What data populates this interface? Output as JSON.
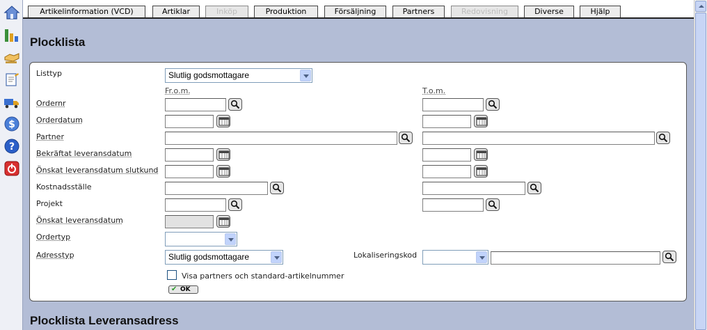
{
  "nav_tabs": [
    {
      "label": "Artikelinformation (VCD)",
      "enabled": true
    },
    {
      "label": "Artiklar",
      "enabled": true
    },
    {
      "label": "Inköp",
      "enabled": false
    },
    {
      "label": "Produktion",
      "enabled": true
    },
    {
      "label": "Försäljning",
      "enabled": true
    },
    {
      "label": "Partners",
      "enabled": true
    },
    {
      "label": "Redovisning",
      "enabled": false
    },
    {
      "label": "Diverse",
      "enabled": true
    },
    {
      "label": "Hjälp",
      "enabled": true
    }
  ],
  "left_icons": [
    "home-icon",
    "chart-icon",
    "handshake-icon",
    "notepad-icon",
    "truck-icon",
    "dollar-icon",
    "help-icon",
    "power-icon"
  ],
  "page": {
    "title": "Plocklista",
    "section2_title": "Plocklista Leveransadress"
  },
  "form": {
    "listtyp_label": "Listtyp",
    "listtyp_value": "Slutlig godsmottagare",
    "from_header": "Fr.o.m.",
    "to_header": "T.o.m.",
    "ordernr_label": "Ordernr",
    "orderdatum_label": "Orderdatum",
    "partner_label": "Partner",
    "bekraftat_label": "Bekräftat leveransdatum",
    "onskat_slutkund_label": "Önskat leveransdatum slutkund",
    "kostnadsstalle_label": "Kostnadsställe",
    "projekt_label": "Projekt",
    "onskat_label": "Önskat leveransdatum",
    "ordertyp_label": "Ordertyp",
    "ordertyp_value": "",
    "adresstyp_label": "Adresstyp",
    "adresstyp_value": "Slutlig godsmottagare",
    "lokalisering_label": "Lokaliseringskod",
    "lokalisering_value": "",
    "visa_partners_label": "Visa partners och standard-artikelnummer",
    "visa_partners_checked": false,
    "ok_label": "OK"
  },
  "colors": {
    "background": "#b3bdd6",
    "panel": "#ffffff",
    "tab_active": "#ececec",
    "tab_disabled_text": "#bdbdbd"
  }
}
